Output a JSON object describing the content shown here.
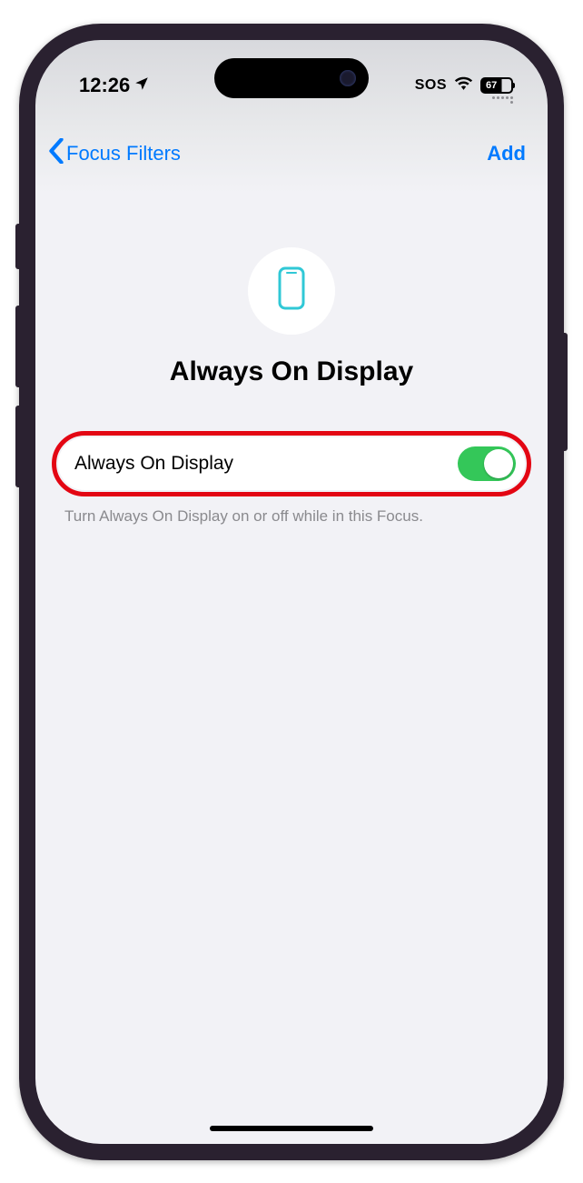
{
  "status": {
    "time": "12:26",
    "sos": "SOS",
    "battery": "67"
  },
  "nav": {
    "back_label": "Focus Filters",
    "add_label": "Add"
  },
  "hero": {
    "title": "Always On Display"
  },
  "setting": {
    "label": "Always On Display",
    "toggle_on": true,
    "footer": "Turn Always On Display on or off while in this Focus."
  }
}
